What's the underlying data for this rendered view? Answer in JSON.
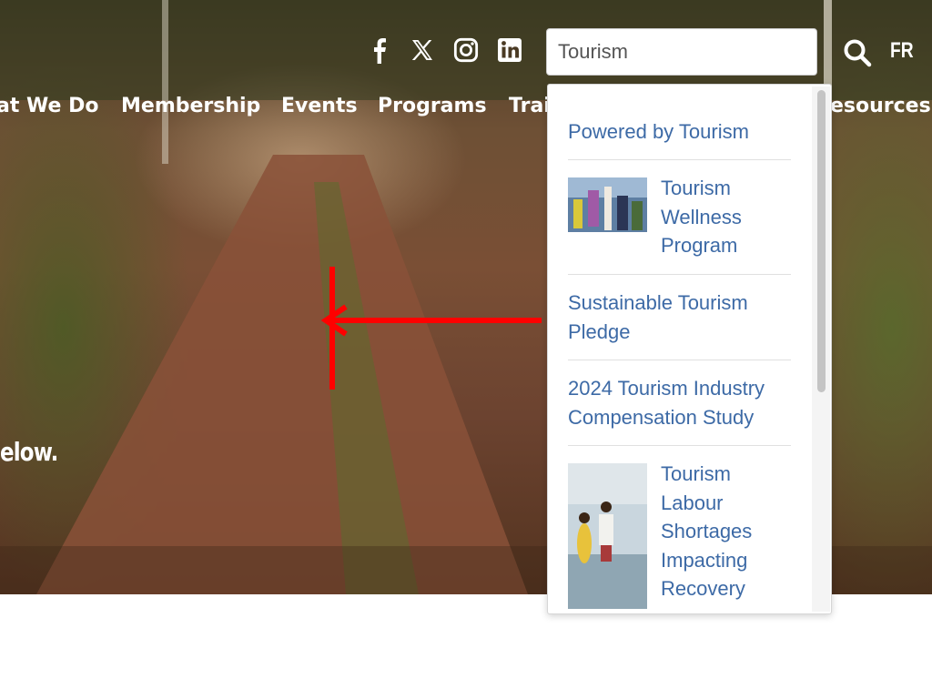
{
  "header": {
    "socials": [
      {
        "icon": "facebook-icon",
        "label": "f"
      },
      {
        "icon": "x-twitter-icon",
        "label": "𝕏"
      },
      {
        "icon": "instagram-icon"
      },
      {
        "icon": "linkedin-icon"
      }
    ],
    "search": {
      "value": "Tourism"
    },
    "search_icon": "search-icon",
    "language_toggle": "FR"
  },
  "nav": {
    "items": [
      "at We Do",
      "Membership",
      "Events",
      "Programs",
      "Trai",
      "esources"
    ]
  },
  "hero": {
    "partial_text": "elow."
  },
  "search_dropdown": {
    "results": [
      {
        "title": "Powered by Tourism",
        "has_image": false
      },
      {
        "title": "Tourism Wellness Program",
        "has_image": true
      },
      {
        "title": "Sustainable Tourism Pledge",
        "has_image": false
      },
      {
        "title": "2024 Tourism Industry Compensation Study",
        "has_image": false
      },
      {
        "title": "Tourism Labour Shortages Impacting Recovery",
        "has_image": true
      }
    ]
  },
  "colors": {
    "link": "#3d6aa6",
    "annotation_arrow": "#ff0000",
    "white": "#ffffff"
  }
}
